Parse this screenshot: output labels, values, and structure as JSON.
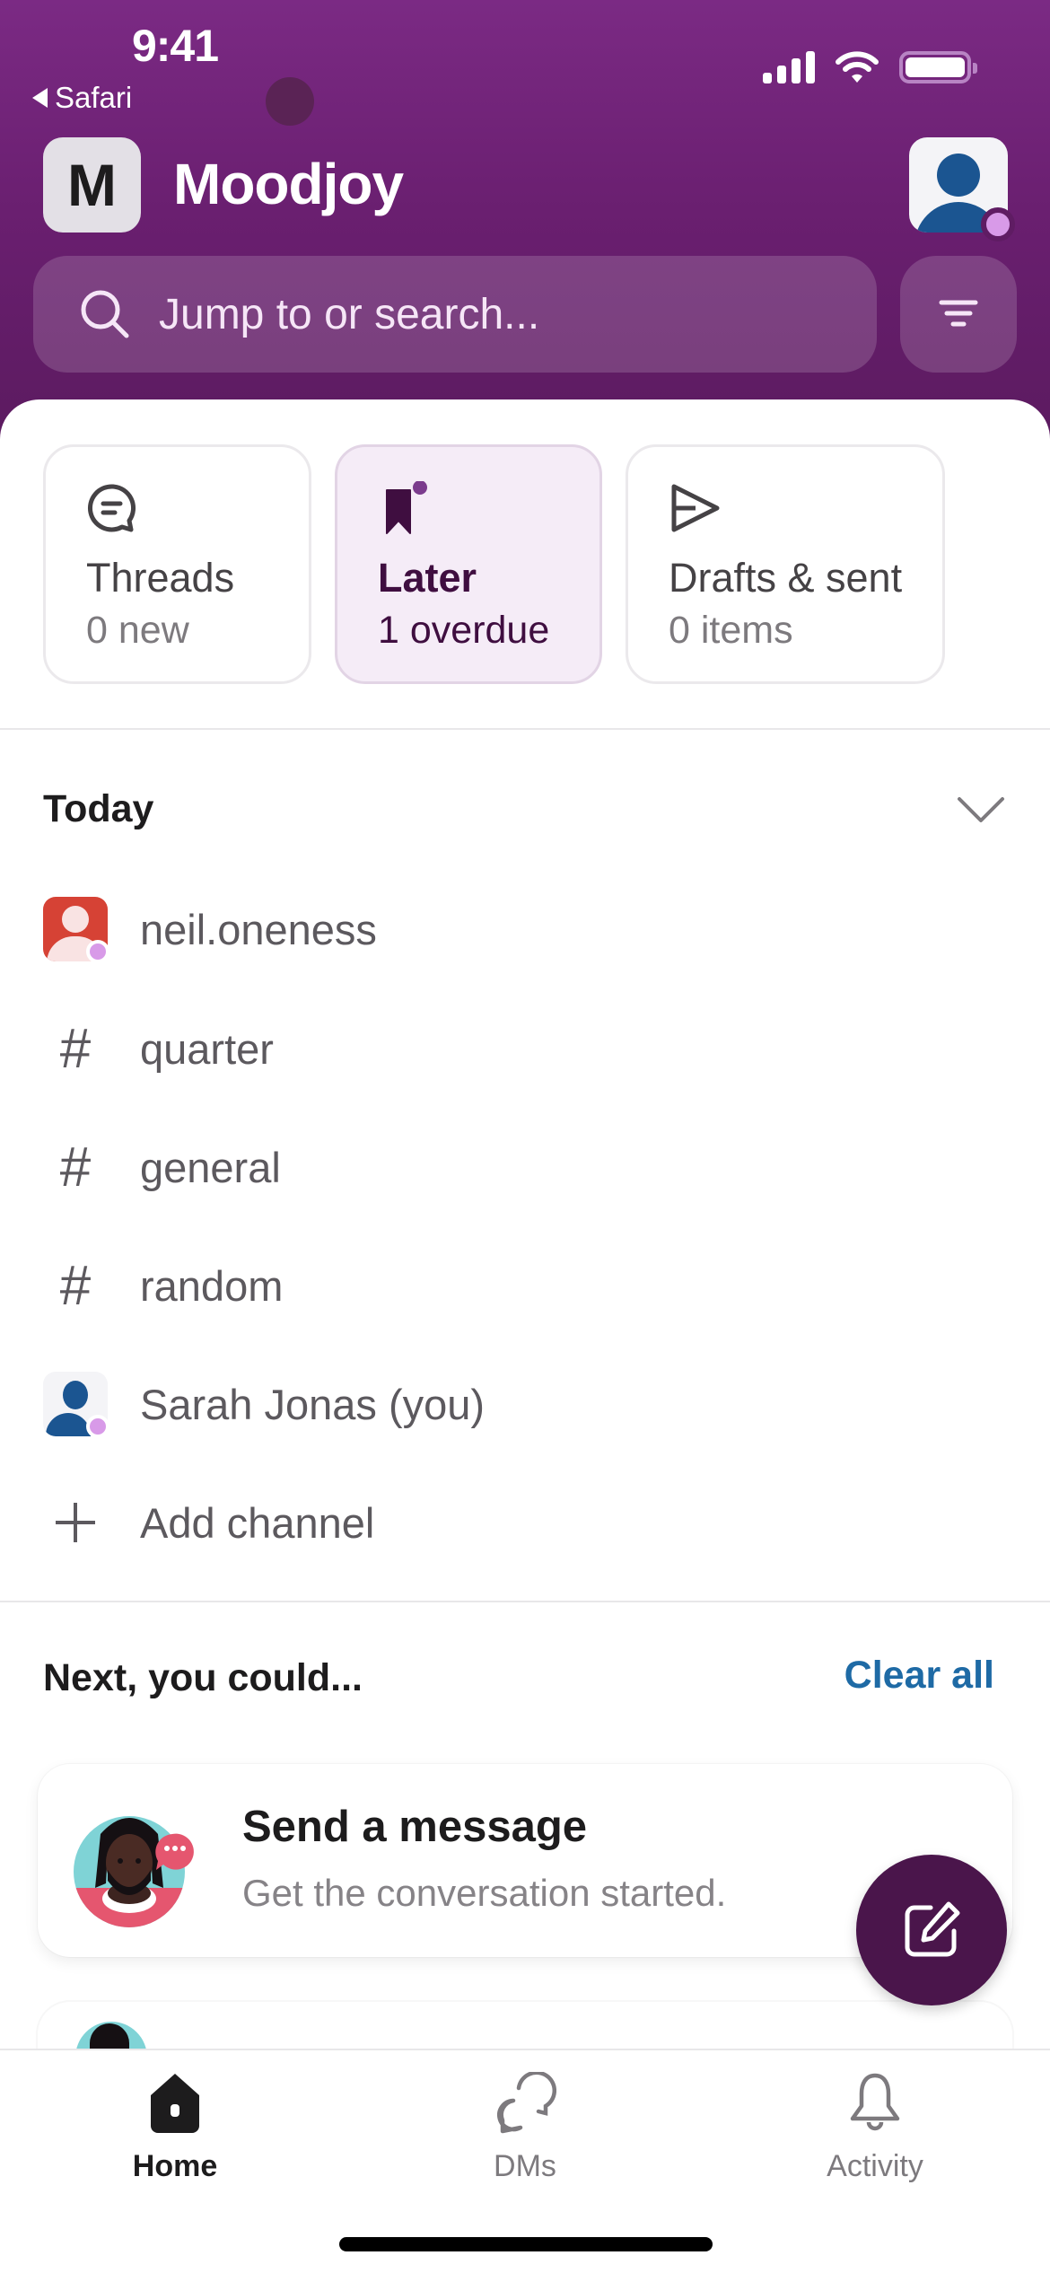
{
  "status_bar": {
    "time": "9:41",
    "back_app": "Safari",
    "signal_icon": "cellular-signal-icon",
    "wifi_icon": "wifi-icon",
    "battery_icon": "battery-icon"
  },
  "header": {
    "workspace_initial": "M",
    "workspace_name": "Moodjoy",
    "search_placeholder": "Jump to or search...",
    "filter_icon": "filter-icon",
    "profile_icon": "user-avatar-icon"
  },
  "quick_cards": [
    {
      "title": "Threads",
      "subtitle": "0 new",
      "icon": "threads-icon",
      "active": false
    },
    {
      "title": "Later",
      "subtitle": "1 overdue",
      "icon": "bookmark-icon",
      "active": true
    },
    {
      "title": "Drafts & sent",
      "subtitle": "0 items",
      "icon": "send-icon",
      "active": false
    }
  ],
  "today": {
    "title": "Today",
    "items": [
      {
        "label": "neil.oneness",
        "type": "dm"
      },
      {
        "label": "quarter",
        "type": "channel"
      },
      {
        "label": "general",
        "type": "channel"
      },
      {
        "label": "random",
        "type": "channel"
      },
      {
        "label": "Sarah Jonas (you)",
        "type": "dm-self"
      },
      {
        "label": "Add channel",
        "type": "action"
      }
    ]
  },
  "next": {
    "title": "Next, you could...",
    "clear_all": "Clear all",
    "cards": [
      {
        "title": "Send a message",
        "subtitle": "Get the conversation started."
      }
    ]
  },
  "tabbar": {
    "tabs": [
      {
        "label": "Home",
        "active": true
      },
      {
        "label": "DMs",
        "active": false
      },
      {
        "label": "Activity",
        "active": false
      }
    ]
  },
  "colors": {
    "brand_aubergine": "#4a154b",
    "header_purple": "#6a1f70",
    "link_blue": "#1e6aa5",
    "presence": "#d89ae8",
    "later_bg": "#f5ecf7"
  }
}
